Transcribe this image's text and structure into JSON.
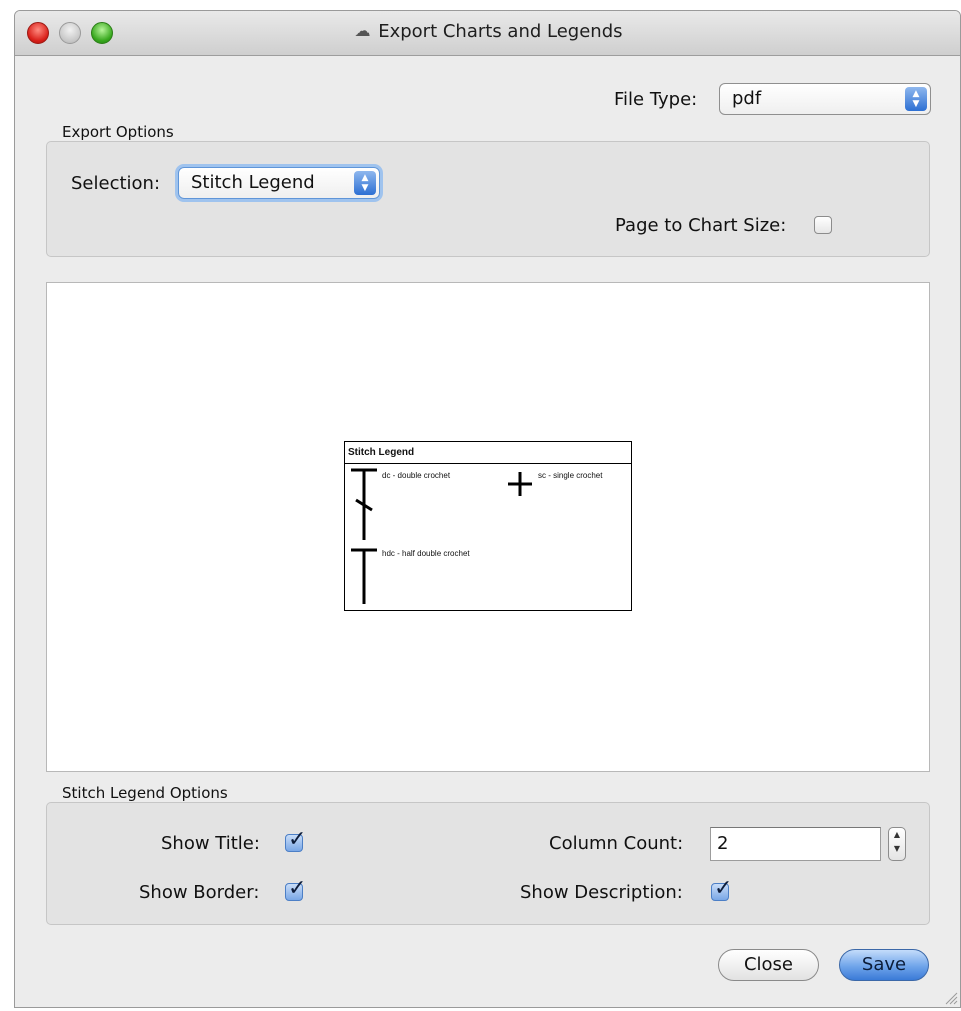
{
  "window": {
    "title": "Export Charts and Legends"
  },
  "file_type": {
    "label": "File Type:",
    "value": "pdf"
  },
  "export_options": {
    "section_label": "Export Options",
    "selection_label": "Selection:",
    "selection_value": "Stitch Legend",
    "page_to_chart_label": "Page to Chart Size:",
    "page_to_chart_checked": false
  },
  "preview": {
    "legend_title": "Stitch Legend",
    "items": [
      {
        "symbol": "double-crochet-symbol",
        "text": "dc - double crochet"
      },
      {
        "symbol": "single-crochet-symbol",
        "text": "sc - single crochet"
      },
      {
        "symbol": "half-double-crochet-symbol",
        "text": "hdc - half double crochet"
      }
    ]
  },
  "legend_options": {
    "section_label": "Stitch Legend Options",
    "show_title_label": "Show Title:",
    "show_title_checked": true,
    "show_border_label": "Show Border:",
    "show_border_checked": true,
    "column_count_label": "Column Count:",
    "column_count_value": "2",
    "show_description_label": "Show Description:",
    "show_description_checked": true
  },
  "buttons": {
    "close_label": "Close",
    "save_label": "Save"
  },
  "colors": {
    "accent_blue": "#3a7ad7",
    "window_bg": "#ececec",
    "close_red": "#d9201a",
    "maximize_green": "#38a81e"
  }
}
